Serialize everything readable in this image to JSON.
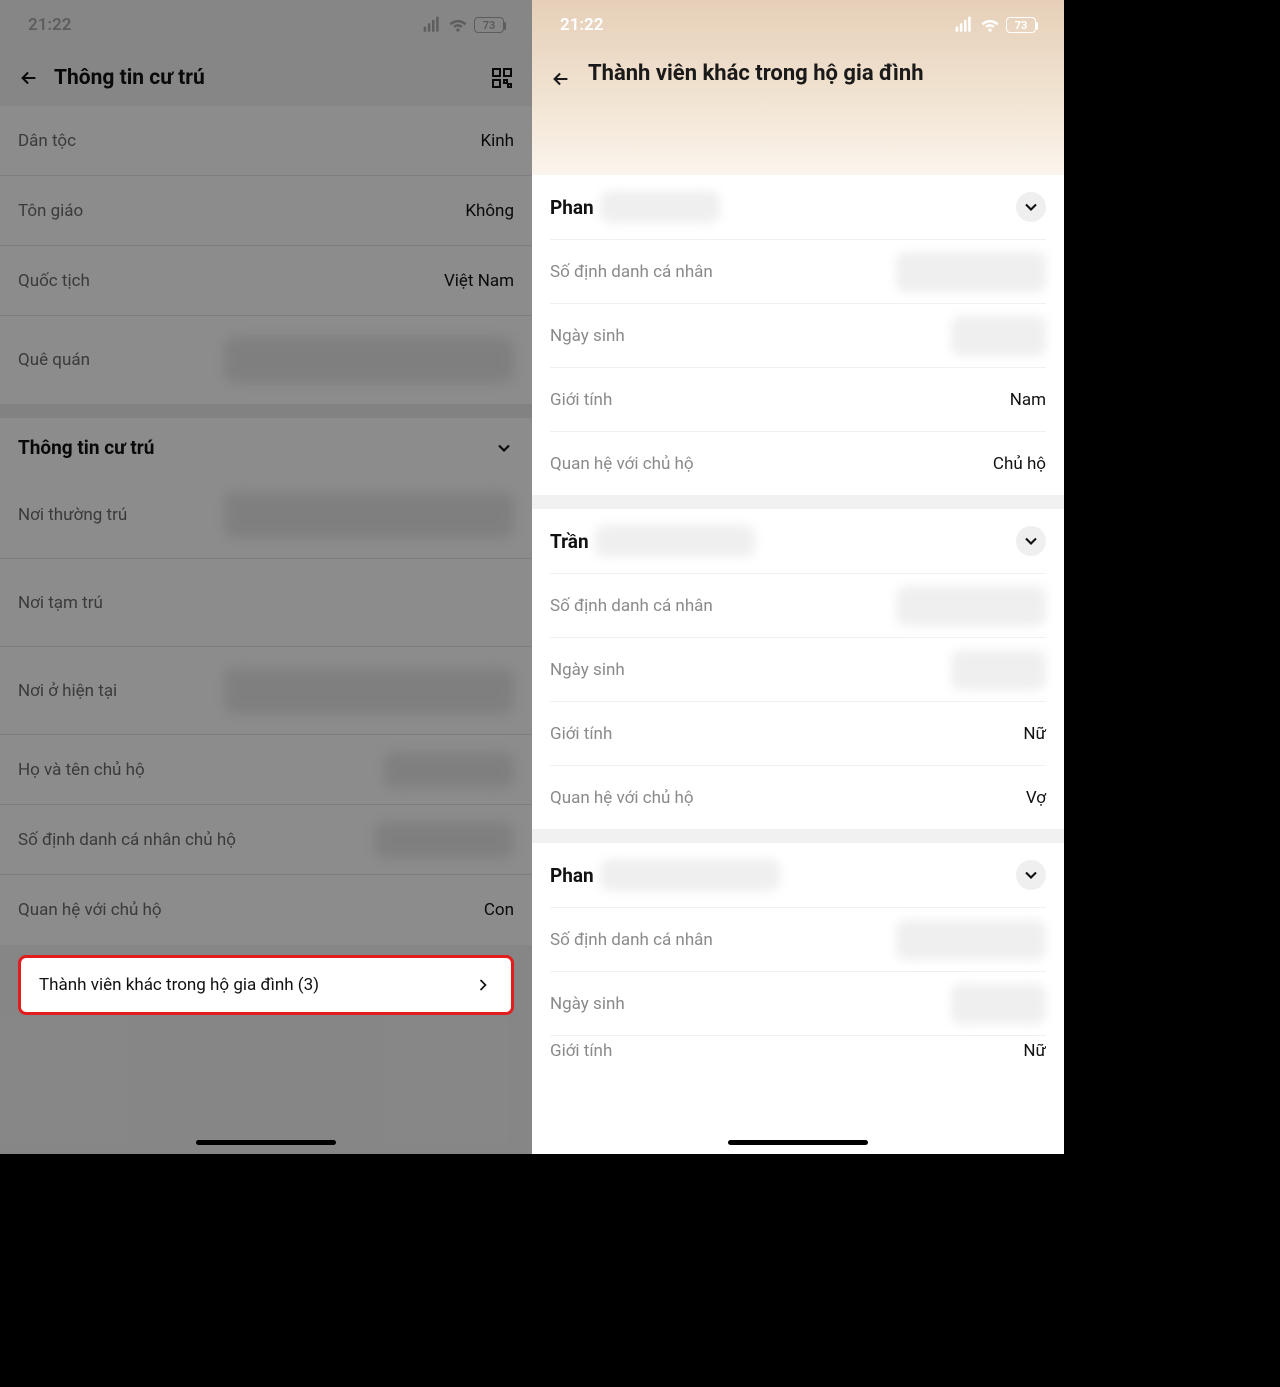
{
  "status": {
    "time": "21:22",
    "battery": "73"
  },
  "left": {
    "title": "Thông tin cư trú",
    "rows": {
      "ethnicity_label": "Dân tộc",
      "ethnicity_value": "Kinh",
      "religion_label": "Tôn giáo",
      "religion_value": "Không",
      "nationality_label": "Quốc tịch",
      "nationality_value": "Việt Nam",
      "hometown_label": "Quê quán"
    },
    "section_title": "Thông tin cư trú",
    "section": {
      "permanent_label": "Nơi thường trú",
      "temporary_label": "Nơi tạm trú",
      "current_label": "Nơi ở hiện tại",
      "head_name_label": "Họ và tên chủ hộ",
      "head_id_label": "Số định danh cá nhân chủ hộ",
      "relation_label": "Quan hệ với chủ hộ",
      "relation_value": "Con"
    },
    "other_members_label": "Thành viên khác trong hộ gia đình (3)"
  },
  "right": {
    "title": "Thành viên khác trong hộ gia đình",
    "labels": {
      "id": "Số định danh cá nhân",
      "dob": "Ngày sinh",
      "gender": "Giới tính",
      "relation": "Quan hệ với chủ hộ"
    },
    "members": [
      {
        "name_prefix": "Phan",
        "gender": "Nam",
        "relation": "Chủ hộ"
      },
      {
        "name_prefix": "Trần",
        "gender": "Nữ",
        "relation": "Vợ"
      },
      {
        "name_prefix": "Phan",
        "gender": "",
        "relation": ""
      }
    ],
    "partial_gender_label": "Giới tính",
    "partial_gender_value": "Nữ"
  }
}
